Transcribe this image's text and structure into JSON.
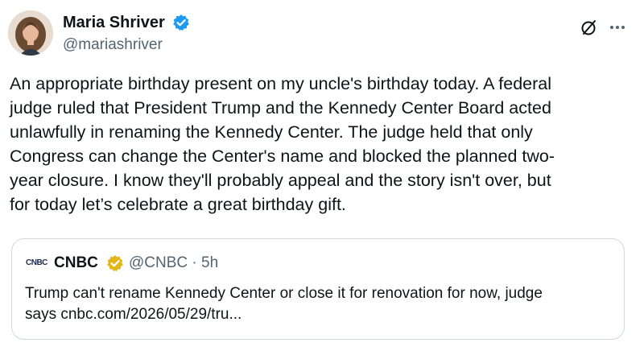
{
  "author": {
    "name": "Maria Shriver",
    "handle": "@mariashriver",
    "verified_color": "#1d9bf0"
  },
  "tweet": {
    "text": "An appropriate birthday present on my uncle's birthday today. A federal\njudge ruled that President Trump and the Kennedy Center Board acted\nunlawfully in renaming the Kennedy Center. The judge held that only\nCongress can change the Center's name and blocked the planned two-\nyear closure. I know they'll probably appeal and the story isn't over, but\nfor today let’s celebrate a great birthday gift."
  },
  "actions": {
    "grok_icon": "grok-icon",
    "more_icon": "more-icon"
  },
  "quote": {
    "logo_text": "CNBC",
    "name": "CNBC",
    "handle_time": "@CNBC · 5h",
    "verified_color": "#e2b719",
    "text": "Trump can't rename Kennedy Center or close it for renovation for now, judge\nsays cnbc.com/2026/05/29/tru..."
  },
  "colors": {
    "text": "#0f1419",
    "secondary": "#536471",
    "border": "#cfd9de"
  }
}
